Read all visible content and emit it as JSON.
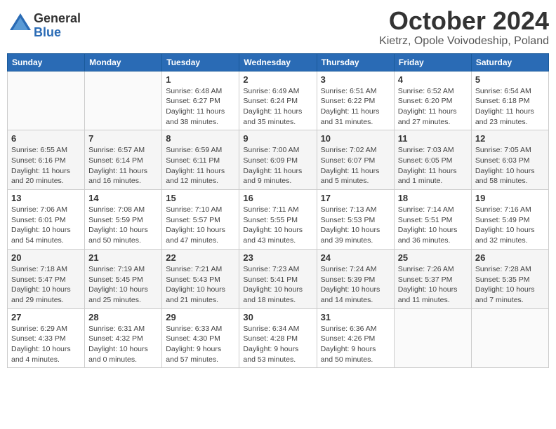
{
  "logo": {
    "general": "General",
    "blue": "Blue"
  },
  "title": "October 2024",
  "location": "Kietrz, Opole Voivodeship, Poland",
  "days_of_week": [
    "Sunday",
    "Monday",
    "Tuesday",
    "Wednesday",
    "Thursday",
    "Friday",
    "Saturday"
  ],
  "weeks": [
    [
      {
        "num": "",
        "info": ""
      },
      {
        "num": "",
        "info": ""
      },
      {
        "num": "1",
        "info": "Sunrise: 6:48 AM\nSunset: 6:27 PM\nDaylight: 11 hours and 38 minutes."
      },
      {
        "num": "2",
        "info": "Sunrise: 6:49 AM\nSunset: 6:24 PM\nDaylight: 11 hours and 35 minutes."
      },
      {
        "num": "3",
        "info": "Sunrise: 6:51 AM\nSunset: 6:22 PM\nDaylight: 11 hours and 31 minutes."
      },
      {
        "num": "4",
        "info": "Sunrise: 6:52 AM\nSunset: 6:20 PM\nDaylight: 11 hours and 27 minutes."
      },
      {
        "num": "5",
        "info": "Sunrise: 6:54 AM\nSunset: 6:18 PM\nDaylight: 11 hours and 23 minutes."
      }
    ],
    [
      {
        "num": "6",
        "info": "Sunrise: 6:55 AM\nSunset: 6:16 PM\nDaylight: 11 hours and 20 minutes."
      },
      {
        "num": "7",
        "info": "Sunrise: 6:57 AM\nSunset: 6:14 PM\nDaylight: 11 hours and 16 minutes."
      },
      {
        "num": "8",
        "info": "Sunrise: 6:59 AM\nSunset: 6:11 PM\nDaylight: 11 hours and 12 minutes."
      },
      {
        "num": "9",
        "info": "Sunrise: 7:00 AM\nSunset: 6:09 PM\nDaylight: 11 hours and 9 minutes."
      },
      {
        "num": "10",
        "info": "Sunrise: 7:02 AM\nSunset: 6:07 PM\nDaylight: 11 hours and 5 minutes."
      },
      {
        "num": "11",
        "info": "Sunrise: 7:03 AM\nSunset: 6:05 PM\nDaylight: 11 hours and 1 minute."
      },
      {
        "num": "12",
        "info": "Sunrise: 7:05 AM\nSunset: 6:03 PM\nDaylight: 10 hours and 58 minutes."
      }
    ],
    [
      {
        "num": "13",
        "info": "Sunrise: 7:06 AM\nSunset: 6:01 PM\nDaylight: 10 hours and 54 minutes."
      },
      {
        "num": "14",
        "info": "Sunrise: 7:08 AM\nSunset: 5:59 PM\nDaylight: 10 hours and 50 minutes."
      },
      {
        "num": "15",
        "info": "Sunrise: 7:10 AM\nSunset: 5:57 PM\nDaylight: 10 hours and 47 minutes."
      },
      {
        "num": "16",
        "info": "Sunrise: 7:11 AM\nSunset: 5:55 PM\nDaylight: 10 hours and 43 minutes."
      },
      {
        "num": "17",
        "info": "Sunrise: 7:13 AM\nSunset: 5:53 PM\nDaylight: 10 hours and 39 minutes."
      },
      {
        "num": "18",
        "info": "Sunrise: 7:14 AM\nSunset: 5:51 PM\nDaylight: 10 hours and 36 minutes."
      },
      {
        "num": "19",
        "info": "Sunrise: 7:16 AM\nSunset: 5:49 PM\nDaylight: 10 hours and 32 minutes."
      }
    ],
    [
      {
        "num": "20",
        "info": "Sunrise: 7:18 AM\nSunset: 5:47 PM\nDaylight: 10 hours and 29 minutes."
      },
      {
        "num": "21",
        "info": "Sunrise: 7:19 AM\nSunset: 5:45 PM\nDaylight: 10 hours and 25 minutes."
      },
      {
        "num": "22",
        "info": "Sunrise: 7:21 AM\nSunset: 5:43 PM\nDaylight: 10 hours and 21 minutes."
      },
      {
        "num": "23",
        "info": "Sunrise: 7:23 AM\nSunset: 5:41 PM\nDaylight: 10 hours and 18 minutes."
      },
      {
        "num": "24",
        "info": "Sunrise: 7:24 AM\nSunset: 5:39 PM\nDaylight: 10 hours and 14 minutes."
      },
      {
        "num": "25",
        "info": "Sunrise: 7:26 AM\nSunset: 5:37 PM\nDaylight: 10 hours and 11 minutes."
      },
      {
        "num": "26",
        "info": "Sunrise: 7:28 AM\nSunset: 5:35 PM\nDaylight: 10 hours and 7 minutes."
      }
    ],
    [
      {
        "num": "27",
        "info": "Sunrise: 6:29 AM\nSunset: 4:33 PM\nDaylight: 10 hours and 4 minutes."
      },
      {
        "num": "28",
        "info": "Sunrise: 6:31 AM\nSunset: 4:32 PM\nDaylight: 10 hours and 0 minutes."
      },
      {
        "num": "29",
        "info": "Sunrise: 6:33 AM\nSunset: 4:30 PM\nDaylight: 9 hours and 57 minutes."
      },
      {
        "num": "30",
        "info": "Sunrise: 6:34 AM\nSunset: 4:28 PM\nDaylight: 9 hours and 53 minutes."
      },
      {
        "num": "31",
        "info": "Sunrise: 6:36 AM\nSunset: 4:26 PM\nDaylight: 9 hours and 50 minutes."
      },
      {
        "num": "",
        "info": ""
      },
      {
        "num": "",
        "info": ""
      }
    ]
  ]
}
